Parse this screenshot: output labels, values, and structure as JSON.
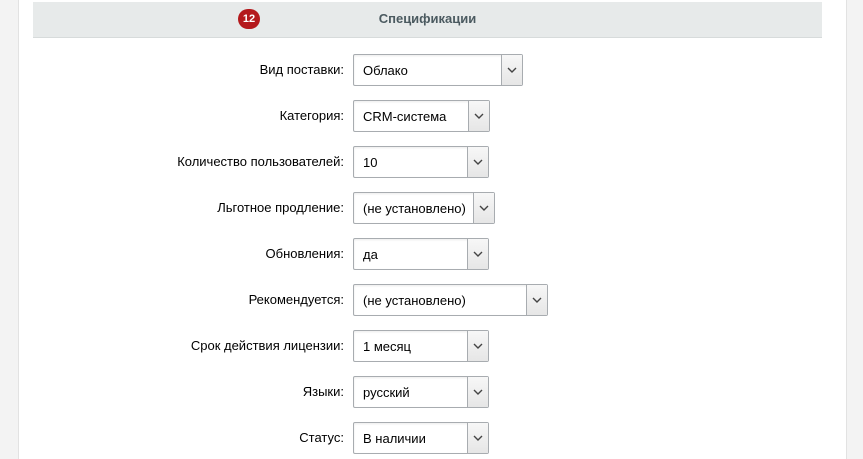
{
  "section": {
    "title": "Спецификации",
    "badge": "12"
  },
  "fields": [
    {
      "label": "Вид поставки:",
      "value": "Облако"
    },
    {
      "label": "Категория:",
      "value": "CRM-система"
    },
    {
      "label": "Количество пользователей:",
      "value": "10"
    },
    {
      "label": "Льготное продление:",
      "value": "(не установлено)"
    },
    {
      "label": "Обновления:",
      "value": "да"
    },
    {
      "label": "Рекомендуется:",
      "value": "(не установлено)"
    },
    {
      "label": "Срок действия лицензии:",
      "value": "1 месяц"
    },
    {
      "label": "Языки:",
      "value": "русский"
    },
    {
      "label": "Статус:",
      "value": "В наличии"
    }
  ]
}
